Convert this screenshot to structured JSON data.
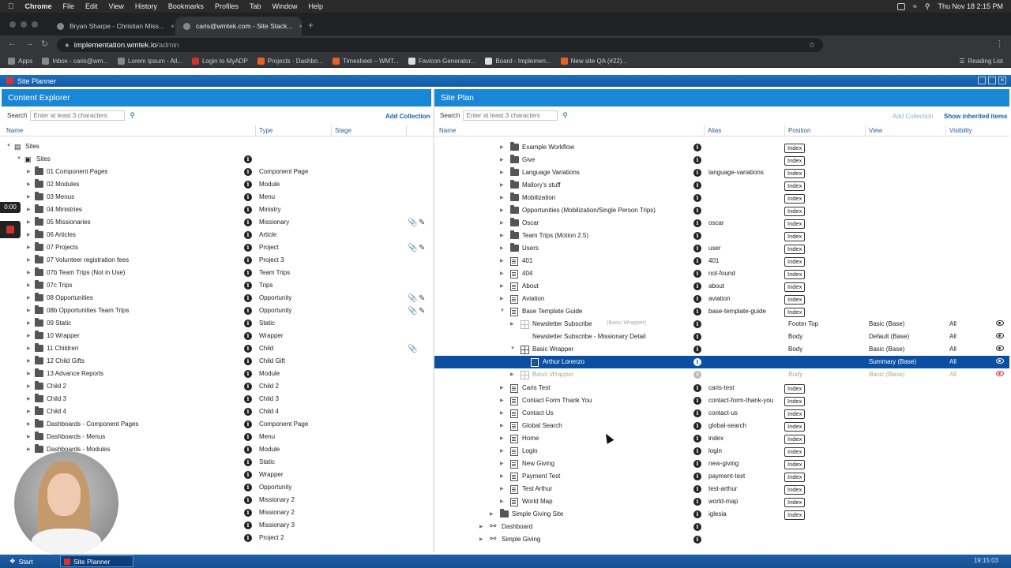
{
  "menubar": {
    "app": "Chrome",
    "items": [
      "File",
      "Edit",
      "View",
      "History",
      "Bookmarks",
      "Profiles",
      "Tab",
      "Window",
      "Help"
    ],
    "clock": "Thu Nov 18  2:15 PM"
  },
  "browser": {
    "tabs": [
      {
        "title": "Bryan Sharpe - Christian Miss..."
      },
      {
        "title": "caris@wmtek.com - Site Stack..."
      }
    ],
    "url_host": "implementation.wmtek.io",
    "url_path": "/admin",
    "bookmarks": [
      "Apps",
      "Inbox - caris@wm...",
      "Lorem Ipsum - All...",
      "Login to MyADP",
      "Projects · Dashbo...",
      "Timesheet – WMT...",
      "Favicon Generator...",
      "Board - Implemen...",
      "New site QA (#22)..."
    ],
    "reading_list": "Reading List"
  },
  "app": {
    "title": "Site Planner",
    "content_explorer": {
      "title": "Content Explorer",
      "search_label": "Search",
      "search_placeholder": "Enter at least 3 characters",
      "add_collection": "Add Collection",
      "columns": {
        "name": "Name",
        "type": "Type",
        "stage": "Stage"
      },
      "root": "Sites",
      "sites_node": "Sites",
      "rows": [
        {
          "name": "01 Component Pages",
          "type": "Component Page",
          "edit": ""
        },
        {
          "name": "02 Modules",
          "type": "Module",
          "edit": ""
        },
        {
          "name": "03 Menus",
          "type": "Menu",
          "edit": ""
        },
        {
          "name": "04 Ministries",
          "type": "Ministry",
          "edit": ""
        },
        {
          "name": "05 Missionaries",
          "type": "Missionary",
          "edit": "both"
        },
        {
          "name": "06 Articles",
          "type": "Article",
          "edit": ""
        },
        {
          "name": "07 Projects",
          "type": "Project",
          "edit": "both"
        },
        {
          "name": "07 Volunteer registration fees",
          "type": "Project 3",
          "edit": ""
        },
        {
          "name": "07b Team Trips (Not in Use)",
          "type": "Team Trips",
          "edit": ""
        },
        {
          "name": "07c Trips",
          "type": "Trips",
          "edit": ""
        },
        {
          "name": "08 Opportunities",
          "type": "Opportunity",
          "edit": "both"
        },
        {
          "name": "08b Opportunities Team Trips",
          "type": "Opportunity",
          "edit": "both"
        },
        {
          "name": "09 Static",
          "type": "Static",
          "edit": ""
        },
        {
          "name": "10 Wrapper",
          "type": "Wrapper",
          "edit": ""
        },
        {
          "name": "11 Children",
          "type": "Child",
          "edit": "clip"
        },
        {
          "name": "12 Child Gifts",
          "type": "Child Gift",
          "edit": ""
        },
        {
          "name": "13 Advance Reports",
          "type": "Module",
          "edit": ""
        },
        {
          "name": "Child 2",
          "type": "Child 2",
          "edit": ""
        },
        {
          "name": "Child 3",
          "type": "Child 3",
          "edit": ""
        },
        {
          "name": "Child 4",
          "type": "Child 4",
          "edit": ""
        },
        {
          "name": "Dashboards - Component Pages",
          "type": "Component Page",
          "edit": ""
        },
        {
          "name": "Dashboards - Menus",
          "type": "Menu",
          "edit": ""
        },
        {
          "name": "Dashboards - Modules",
          "type": "Module",
          "edit": ""
        },
        {
          "name": "",
          "type": "Static",
          "edit": ""
        },
        {
          "name": "",
          "type": "Wrapper",
          "edit": ""
        },
        {
          "name": "",
          "type": "Opportunity",
          "edit": ""
        },
        {
          "name": "",
          "type": "Missionary 2",
          "edit": ""
        },
        {
          "name": "",
          "type": "Missionary 2",
          "edit": ""
        },
        {
          "name": "",
          "type": "Missionary 3",
          "edit": ""
        },
        {
          "name": "",
          "type": "Project 2",
          "edit": ""
        }
      ]
    },
    "site_plan": {
      "title": "Site Plan",
      "search_label": "Search",
      "search_placeholder": "Enter at least 3 characters",
      "add_collection": "Add Collection",
      "show_inherited": "Show inherited items",
      "columns": {
        "name": "Name",
        "alias": "Alias",
        "position": "Position",
        "view": "View",
        "visibility": "Visibility"
      },
      "rows": [
        {
          "name": "Example Workflow",
          "icon": "folder",
          "indent": 3,
          "alias": "",
          "position": "Index",
          "view": "",
          "visibility": "",
          "kind": "normal"
        },
        {
          "name": "Give",
          "icon": "folder",
          "indent": 3,
          "alias": "",
          "position": "Index",
          "view": "",
          "visibility": "",
          "kind": "normal"
        },
        {
          "name": "Language Variations",
          "icon": "folder",
          "indent": 3,
          "alias": "language-variations",
          "position": "Index",
          "view": "",
          "visibility": "",
          "kind": "normal"
        },
        {
          "name": "Mallory's stuff",
          "icon": "folder",
          "indent": 3,
          "alias": "",
          "position": "Index",
          "view": "",
          "visibility": "",
          "kind": "normal"
        },
        {
          "name": "Mobilization",
          "icon": "folder",
          "indent": 3,
          "alias": "",
          "position": "Index",
          "view": "",
          "visibility": "",
          "kind": "normal"
        },
        {
          "name": "Opportunities (Mobilization/Single Person Trips)",
          "icon": "folder",
          "indent": 3,
          "alias": "",
          "position": "Index",
          "view": "",
          "visibility": "",
          "kind": "normal"
        },
        {
          "name": "Oscar",
          "icon": "folder",
          "indent": 3,
          "alias": "oscar",
          "position": "Index",
          "view": "",
          "visibility": "",
          "kind": "normal"
        },
        {
          "name": "Team Trips (Motion 2.5)",
          "icon": "folder",
          "indent": 3,
          "alias": "",
          "position": "Index",
          "view": "",
          "visibility": "",
          "kind": "normal"
        },
        {
          "name": "Users",
          "icon": "folder",
          "indent": 3,
          "alias": "user",
          "position": "Index",
          "view": "",
          "visibility": "",
          "kind": "normal"
        },
        {
          "name": "401",
          "icon": "page",
          "indent": 3,
          "alias": "401",
          "position": "Index",
          "view": "",
          "visibility": "",
          "kind": "normal"
        },
        {
          "name": "404",
          "icon": "page",
          "indent": 3,
          "alias": "not-found",
          "position": "Index",
          "view": "",
          "visibility": "",
          "kind": "normal"
        },
        {
          "name": "About",
          "icon": "page",
          "indent": 3,
          "alias": "about",
          "position": "Index",
          "view": "",
          "visibility": "",
          "kind": "normal"
        },
        {
          "name": "Aviation",
          "icon": "page",
          "indent": 3,
          "alias": "aviation",
          "position": "Index",
          "view": "",
          "visibility": "",
          "kind": "normal"
        },
        {
          "name": "Base Template Guide",
          "icon": "page",
          "indent": 3,
          "alias": "base-template-guide",
          "position": "Index",
          "view": "",
          "visibility": "",
          "kind": "expanded"
        },
        {
          "name": "Newsletter Subscribe",
          "suffix": "(Basic Wrapper)",
          "icon": "grid",
          "indent": 4,
          "alias": "",
          "position": "Footer Top",
          "view": "Basic (Base)",
          "visibility": "All",
          "kind": "module"
        },
        {
          "name": "Newsletter Subscribe - Missionary Detail",
          "icon": "none",
          "indent": 4,
          "alias": "",
          "position": "Body",
          "view": "Default (Base)",
          "visibility": "All",
          "kind": "module"
        },
        {
          "name": "Basic Wrapper",
          "icon": "griddark",
          "indent": 4,
          "alias": "",
          "position": "Body",
          "view": "Basic (Base)",
          "visibility": "All",
          "kind": "module-expanded"
        },
        {
          "name": "Arthur Lorenzo",
          "icon": "pagewhite",
          "indent": 5,
          "alias": "",
          "position": "",
          "view": "Summary (Base)",
          "visibility": "All",
          "kind": "selected"
        },
        {
          "name": "Basic Wrapper",
          "icon": "grid",
          "indent": 4,
          "alias": "",
          "position": "Body",
          "view": "Basic (Base)",
          "visibility": "All",
          "kind": "inherited"
        },
        {
          "name": "Caris Test",
          "icon": "page",
          "indent": 3,
          "alias": "caris-test",
          "position": "Index",
          "view": "",
          "visibility": "",
          "kind": "normal"
        },
        {
          "name": "Contact Form Thank You",
          "icon": "page",
          "indent": 3,
          "alias": "contact-form-thank-you",
          "position": "Index",
          "view": "",
          "visibility": "",
          "kind": "normal"
        },
        {
          "name": "Contact Us",
          "icon": "page",
          "indent": 3,
          "alias": "contact-us",
          "position": "Index",
          "view": "",
          "visibility": "",
          "kind": "normal"
        },
        {
          "name": "Global Search",
          "icon": "page",
          "indent": 3,
          "alias": "global-search",
          "position": "Index",
          "view": "",
          "visibility": "",
          "kind": "normal"
        },
        {
          "name": "Home",
          "icon": "page",
          "indent": 3,
          "alias": "index",
          "position": "Index",
          "view": "",
          "visibility": "",
          "kind": "normal"
        },
        {
          "name": "Login",
          "icon": "page",
          "indent": 3,
          "alias": "login",
          "position": "Index",
          "view": "",
          "visibility": "",
          "kind": "normal"
        },
        {
          "name": "New Giving",
          "icon": "page",
          "indent": 3,
          "alias": "new-giving",
          "position": "Index",
          "view": "",
          "visibility": "",
          "kind": "normal"
        },
        {
          "name": "Payment Test",
          "icon": "page",
          "indent": 3,
          "alias": "payment-test",
          "position": "Index",
          "view": "",
          "visibility": "",
          "kind": "normal"
        },
        {
          "name": "Test Arthur",
          "icon": "page",
          "indent": 3,
          "alias": "test-arthur",
          "position": "Index",
          "view": "",
          "visibility": "",
          "kind": "normal"
        },
        {
          "name": "World Map",
          "icon": "page",
          "indent": 3,
          "alias": "world-map",
          "position": "Index",
          "view": "",
          "visibility": "",
          "kind": "normal"
        },
        {
          "name": "Simple Giving Site",
          "icon": "folder",
          "indent": 2,
          "alias": "iglesia",
          "position": "Index",
          "view": "",
          "visibility": "",
          "kind": "normal"
        },
        {
          "name": "Dashboard",
          "icon": "link",
          "indent": 1,
          "alias": "",
          "position": "",
          "view": "",
          "visibility": "",
          "kind": "normal"
        },
        {
          "name": "Simple Giving",
          "icon": "link",
          "indent": 1,
          "alias": "",
          "position": "",
          "view": "",
          "visibility": "",
          "kind": "normal"
        }
      ]
    }
  },
  "recording": {
    "timer": "0:00"
  },
  "taskbar": {
    "start": "Start",
    "task": "Site Planner",
    "clock": "19:15:03"
  }
}
